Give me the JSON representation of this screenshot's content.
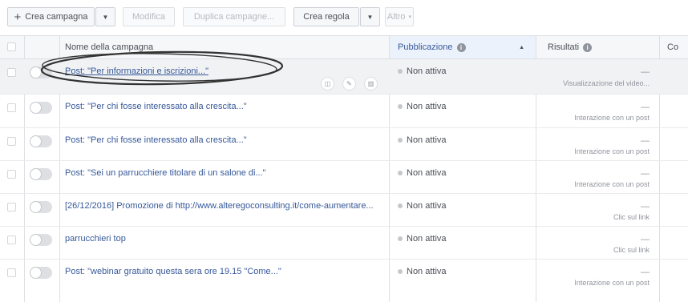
{
  "toolbar": {
    "create_campaign_label": "Crea campagna",
    "edit_label": "Modifica",
    "duplicate_label": "Duplica campagne...",
    "create_rule_label": "Crea regola",
    "more_label": "Altro"
  },
  "table": {
    "columns": {
      "name": "Nome della campagna",
      "publication": "Pubblicazione",
      "results": "Risultati",
      "cost_partial": "Co"
    },
    "rows": [
      {
        "name": "Post: \"Per informazioni e iscrizioni...\"",
        "status": "Non attiva",
        "result_value": "—",
        "result_label": "Visualizzazione del video..."
      },
      {
        "name": "Post: \"Per chi fosse interessato alla crescita...\"",
        "status": "Non attiva",
        "result_value": "—",
        "result_label": "Interazione con un post"
      },
      {
        "name": "Post: \"Per chi fosse interessato alla crescita...\"",
        "status": "Non attiva",
        "result_value": "—",
        "result_label": "Interazione con un post"
      },
      {
        "name": "Post: \"Sei un parrucchiere titolare di un salone di...\"",
        "status": "Non attiva",
        "result_value": "—",
        "result_label": "Interazione con un post"
      },
      {
        "name": "[26/12/2016] Promozione di http://www.alteregoconsulting.it/come-aumentare...",
        "status": "Non attiva",
        "result_value": "—",
        "result_label": "Clic sul link"
      },
      {
        "name": "parrucchieri top",
        "status": "Non attiva",
        "result_value": "—",
        "result_label": "Clic sul link"
      },
      {
        "name": "Post: \"webinar gratuito questa sera ore 19.15 \"Come...\"",
        "status": "Non attiva",
        "result_value": "—",
        "result_label": "Interazione con un post"
      }
    ]
  },
  "colors": {
    "link": "#365899",
    "header_bg": "#f6f7f9",
    "sorted_header_bg": "#ecf2fc",
    "highlight_row_bg": "#f1f2f4"
  }
}
